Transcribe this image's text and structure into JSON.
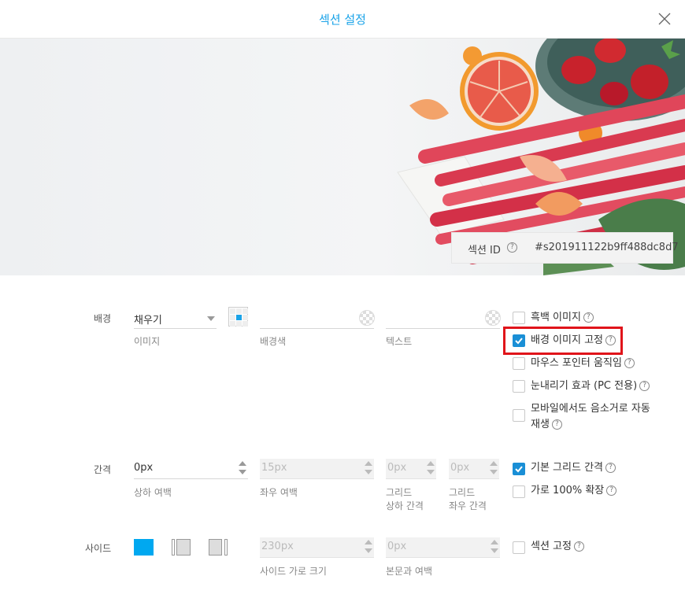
{
  "header": {
    "title": "섹션 설정",
    "close_icon": "close-icon"
  },
  "hero": {
    "section_id_label": "섹션 ID",
    "section_id_value": "#s201911122b9ff488dc8d7"
  },
  "background": {
    "label": "배경",
    "fill_select": "채우기",
    "image_label": "이미지",
    "bg_color_label": "배경색",
    "text_label": "텍스트",
    "options": [
      {
        "label": "흑백 이미지",
        "checked": false
      },
      {
        "label": "배경 이미지 고정",
        "checked": true
      },
      {
        "label": "마우스 포인터 움직임",
        "checked": false
      },
      {
        "label": "눈내리기 효과 (PC 전용)",
        "checked": false
      },
      {
        "label_line1": "모바일에서도 음소거로 자동",
        "label_line2": "재생",
        "checked": false
      }
    ]
  },
  "spacing": {
    "label": "간격",
    "vertical_value": "0px",
    "vertical_label": "상하 여백",
    "horizontal_value": "15px",
    "horizontal_label": "좌우 여백",
    "grid_v_value": "0px",
    "grid_v_label1": "그리드",
    "grid_v_label2": "상하 간격",
    "grid_h_value": "0px",
    "grid_h_label1": "그리드",
    "grid_h_label2": "좌우 간격",
    "options": [
      {
        "label": "기본 그리드 간격",
        "checked": true
      },
      {
        "label": "가로 100% 확장",
        "checked": false
      }
    ]
  },
  "side": {
    "label": "사이드",
    "width_value": "230px",
    "width_label": "사이드 가로 크기",
    "body_margin_value": "0px",
    "body_margin_label": "본문과 여백",
    "options": [
      {
        "label": "섹션 고정",
        "checked": false
      }
    ]
  },
  "colors": {
    "accent": "#1aa3e8",
    "highlight": "#e0141a"
  }
}
